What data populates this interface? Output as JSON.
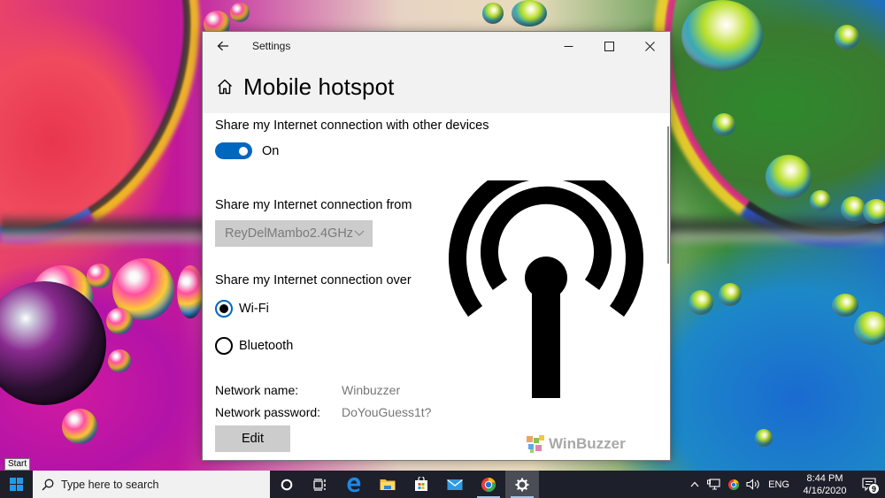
{
  "window": {
    "app_title": "Settings",
    "back_icon": "arrow-left-icon",
    "controls": {
      "minimize_icon": "minimize-icon",
      "maximize_icon": "maximize-icon",
      "close_icon": "close-icon"
    }
  },
  "page": {
    "home_icon": "home-icon",
    "title": "Mobile hotspot"
  },
  "settings": {
    "share_label": "Share my Internet connection with other devices",
    "share_toggle": {
      "state": "On",
      "on": true,
      "accent": "#0067c0"
    },
    "from_label": "Share my Internet connection from",
    "from_selected": "ReyDelMambo2.4GHz",
    "over_label": "Share my Internet connection over",
    "over_options": [
      {
        "label": "Wi-Fi",
        "checked": true
      },
      {
        "label": "Bluetooth",
        "checked": false
      }
    ],
    "network_name_label": "Network name:",
    "network_name_value": "Winbuzzer",
    "network_password_label": "Network password:",
    "network_password_value": "DoYouGuess1t?",
    "edit_label": "Edit"
  },
  "graphic": {
    "icon": "hotspot-broadcast-icon"
  },
  "watermark": {
    "text": "WinBuzzer"
  },
  "tooltip": {
    "text": "Start"
  },
  "taskbar": {
    "search_placeholder": "Type here to search",
    "pinned": [
      {
        "name": "cortana",
        "icon": "cortana-icon"
      },
      {
        "name": "task-view",
        "icon": "task-view-icon"
      },
      {
        "name": "edge",
        "icon": "edge-icon"
      },
      {
        "name": "file-explorer",
        "icon": "folder-icon"
      },
      {
        "name": "store",
        "icon": "store-icon"
      },
      {
        "name": "mail",
        "icon": "mail-icon"
      },
      {
        "name": "chrome-canary",
        "icon": "browser-icon"
      },
      {
        "name": "settings",
        "icon": "gear-icon"
      }
    ],
    "tray": {
      "language": "ENG",
      "time": "8:44 PM",
      "date": "4/16/2020",
      "notifications_count": "9"
    }
  }
}
